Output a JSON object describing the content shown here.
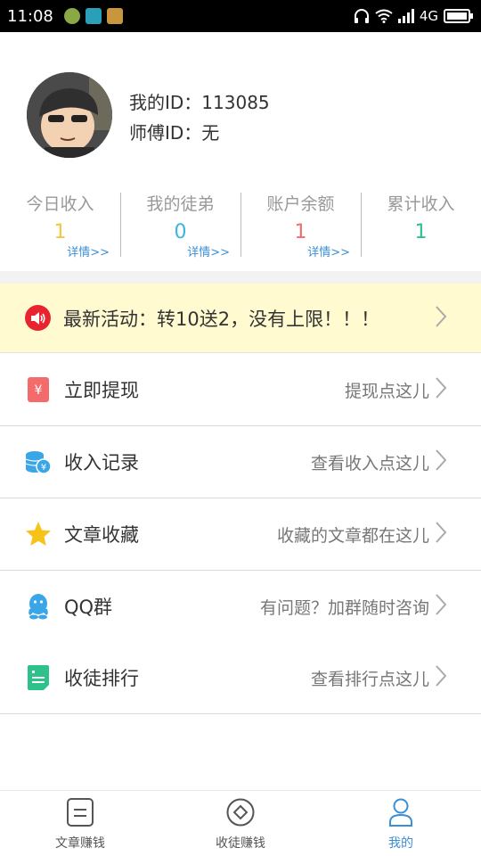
{
  "status_bar": {
    "time": "11:08",
    "network": "4G"
  },
  "profile": {
    "my_id": "我的ID：113085",
    "master_id": "师傅ID：无"
  },
  "stats": [
    {
      "label": "今日收入",
      "value": "1",
      "value_color": "#f5c542",
      "link": "详情>>"
    },
    {
      "label": "我的徒弟",
      "value": "0",
      "value_color": "#39b6e0",
      "link": "详情>>"
    },
    {
      "label": "账户余额",
      "value": "1",
      "value_color": "#f06e6e",
      "link": "详情>>"
    },
    {
      "label": "累计收入",
      "value": "1",
      "value_color": "#2cc28a",
      "link": ""
    }
  ],
  "banner": {
    "text": "最新活动：转10送2，没有上限！！！",
    "icon": "speaker-icon"
  },
  "menu": [
    {
      "label": "立即提现",
      "hint": "提现点这儿",
      "icon": "withdraw-icon",
      "icon_color": "#f36b6b"
    },
    {
      "label": "收入记录",
      "hint": "查看收入点这儿",
      "icon": "coins-icon",
      "icon_color": "#3aa6e8"
    },
    {
      "label": "文章收藏",
      "hint": "收藏的文章都在这儿",
      "icon": "star-icon",
      "icon_color": "#f7c31a"
    },
    {
      "label": "QQ群",
      "hint": "有问题？加群随时咨询",
      "icon": "qq-icon",
      "icon_color": "#3aa6e8"
    },
    {
      "label": "收徒排行",
      "hint": "查看排行点这儿",
      "icon": "ranking-icon",
      "icon_color": "#2cc28a"
    }
  ],
  "bottom_nav": [
    {
      "label": "文章赚钱",
      "icon": "article-icon",
      "active": false
    },
    {
      "label": "收徒赚钱",
      "icon": "diamond-icon",
      "active": false
    },
    {
      "label": "我的",
      "icon": "user-icon",
      "active": true
    }
  ],
  "colors": {
    "accent": "#3b8fd6",
    "banner_bg": "#fffad0",
    "divider": "#d9d9d9"
  }
}
